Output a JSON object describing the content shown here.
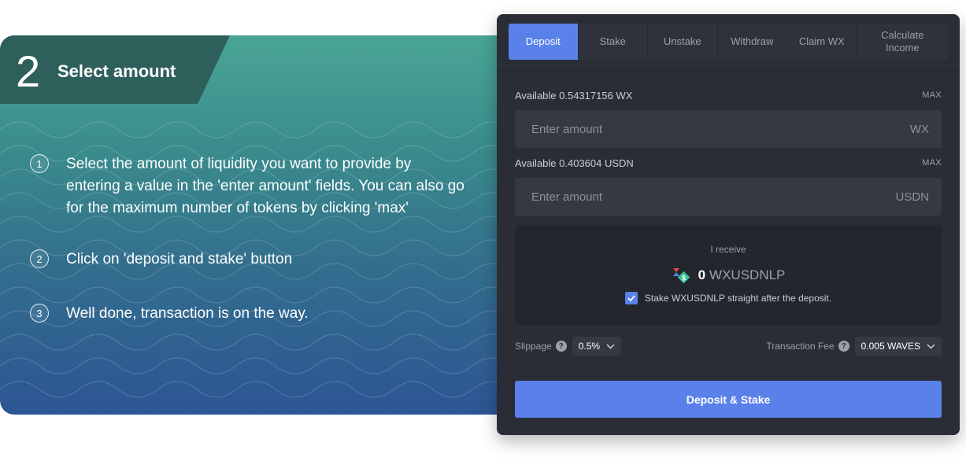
{
  "banner": {
    "step_number": "2",
    "step_title": "Select amount",
    "instructions": [
      {
        "num": "1",
        "text": "Select the amount of liquidity you want to provide by entering a value in the 'enter amount' fields. You can also go for the maximum number of tokens by clicking 'max'"
      },
      {
        "num": "2",
        "text": "Click on 'deposit and stake' button"
      },
      {
        "num": "3",
        "text": "Well done, transaction is on the way."
      }
    ]
  },
  "panel": {
    "tabs": [
      {
        "label": "Deposit",
        "active": true
      },
      {
        "label": "Stake",
        "active": false
      },
      {
        "label": "Unstake",
        "active": false
      },
      {
        "label": "Withdraw",
        "active": false
      },
      {
        "label": "Claim WX",
        "active": false
      },
      {
        "label": "Calculate Income",
        "active": false
      }
    ],
    "wx": {
      "available": "Available 0.54317156 WX",
      "max": "MAX",
      "placeholder": "Enter amount",
      "currency": "WX"
    },
    "usdn": {
      "available": "Available 0.403604 USDN",
      "max": "MAX",
      "placeholder": "Enter amount",
      "currency": "USDN"
    },
    "receive": {
      "label": "I receive",
      "amount": "0",
      "token": "WXUSDNLP",
      "stake_label": "Stake WXUSDNLP straight after the deposit.",
      "stake_checked": true
    },
    "slippage": {
      "label": "Slippage",
      "value": "0.5%"
    },
    "fee": {
      "label": "Transaction Fee",
      "value": "0.005 WAVES"
    },
    "submit": "Deposit & Stake"
  },
  "colors": {
    "accent": "#5a81ea",
    "panel_bg": "#2a2d35",
    "hero_top": "#4aa595",
    "hero_bottom": "#2d5594"
  }
}
